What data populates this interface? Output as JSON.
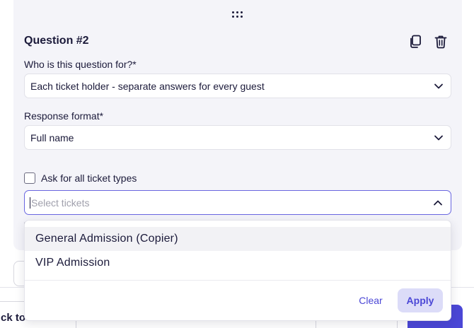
{
  "question": {
    "title": "Question #2",
    "audience_label": "Who is this question for?*",
    "audience_value": "Each ticket holder - separate answers for every guest",
    "format_label": "Response format*",
    "format_value": "Full name",
    "all_tickets_label": "Ask for all ticket types",
    "all_tickets_checked": false,
    "ticket_select_placeholder": "Select tickets"
  },
  "dropdown": {
    "options": [
      {
        "label": "General Admission (Copier)",
        "highlighted": true
      },
      {
        "label": "VIP Admission",
        "highlighted": false
      }
    ],
    "clear_label": "Clear",
    "apply_label": "Apply"
  },
  "footer": {
    "back_label": "ck to d"
  },
  "icons": {
    "drag": "drag-handle-icon",
    "copy": "copy-icon",
    "delete": "trash-icon",
    "chevron_down": "chevron-down-icon",
    "chevron_up": "chevron-up-icon"
  },
  "colors": {
    "accent": "#4b47d6",
    "focus_border": "#6966e0",
    "apply_bg": "#dcdcf8",
    "card_bg": "#f4f4f9"
  }
}
